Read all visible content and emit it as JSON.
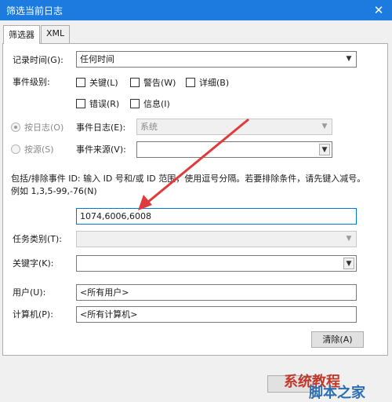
{
  "window": {
    "title": "筛选当前日志"
  },
  "tabs": [
    {
      "label": "筛选器"
    },
    {
      "label": "XML"
    }
  ],
  "logged": {
    "label": "记录时间(G):",
    "value": "任何时间"
  },
  "level": {
    "label": "事件级别:",
    "options": [
      {
        "label": "关键(L)",
        "checked": false
      },
      {
        "label": "警告(W)",
        "checked": false
      },
      {
        "label": "详细(B)",
        "checked": false
      },
      {
        "label": "错误(R)",
        "checked": false
      },
      {
        "label": "信息(I)",
        "checked": false
      }
    ]
  },
  "by_log": {
    "radio_label": "按日志(O)",
    "selected": true,
    "field_label": "事件日志(E):",
    "value": "系统"
  },
  "by_source": {
    "radio_label": "按源(S)",
    "selected": false,
    "field_label": "事件来源(V):",
    "value": ""
  },
  "event_ids": {
    "description": "包括/排除事件 ID: 输入 ID 号和/或 ID 范围，使用逗号分隔。若要排除条件，请先键入减号。例如 1,3,5-99,-76(N)",
    "value": "1074,6006,6008"
  },
  "task_category": {
    "label": "任务类别(T):",
    "value": ""
  },
  "keywords": {
    "label": "关键字(K):",
    "value": ""
  },
  "user": {
    "label": "用户(U):",
    "value": "<所有用户>"
  },
  "computer": {
    "label": "计算机(P):",
    "value": "<所有计算机>"
  },
  "clear_button": "清除(A)",
  "watermark": {
    "line1": "系统教程",
    "line2": "脚本之家"
  },
  "colors": {
    "titlebar": "#1d7be0",
    "arrow": "#e03a3a",
    "focus": "#0078d7"
  }
}
